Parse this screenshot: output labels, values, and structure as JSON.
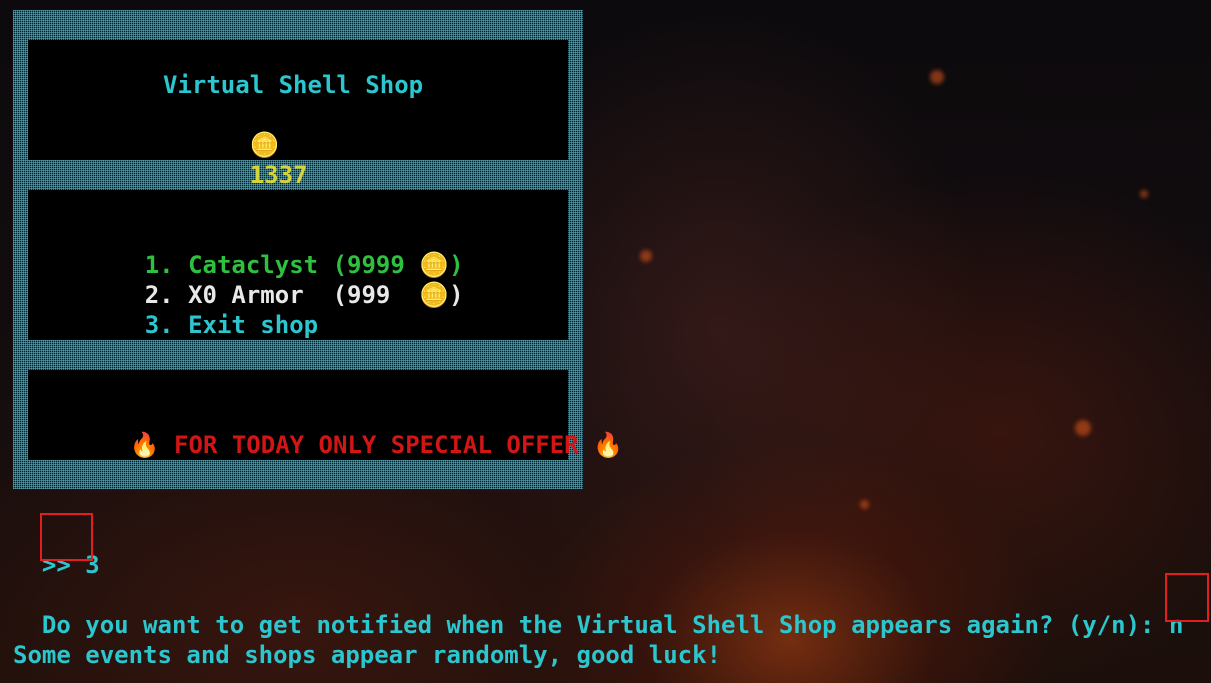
{
  "shop": {
    "title": "Virtual Shell Shop",
    "coin_icon": "🪙",
    "balance": "1337",
    "items": [
      {
        "number": "1.",
        "name": "Cataclyst",
        "price": "(9999",
        "close": ")",
        "color": "#30c040"
      },
      {
        "number": "2.",
        "name": "X0 Armor",
        "price": "(999",
        "close": ")",
        "color": "#e8e8e8"
      },
      {
        "number": "3.",
        "name": "Exit shop",
        "price": "",
        "close": "",
        "color": "#2cc6cf"
      }
    ],
    "offer": {
      "fire_icon": "🔥",
      "text": "FOR TODAY ONLY SPECIAL OFFER"
    }
  },
  "terminal": {
    "prompt_symbol": ">>",
    "input_value": "3",
    "question": "Do you want to get notified when the Virtual Shell Shop appears again? (y/n):",
    "answer": "n",
    "final_message": "Some events and shops appear randomly, good luck!"
  },
  "colors": {
    "accent": "#2cc6cf",
    "balance": "#d6d23a",
    "highlight_box": "#e21e1e",
    "offer": "#d21515"
  }
}
